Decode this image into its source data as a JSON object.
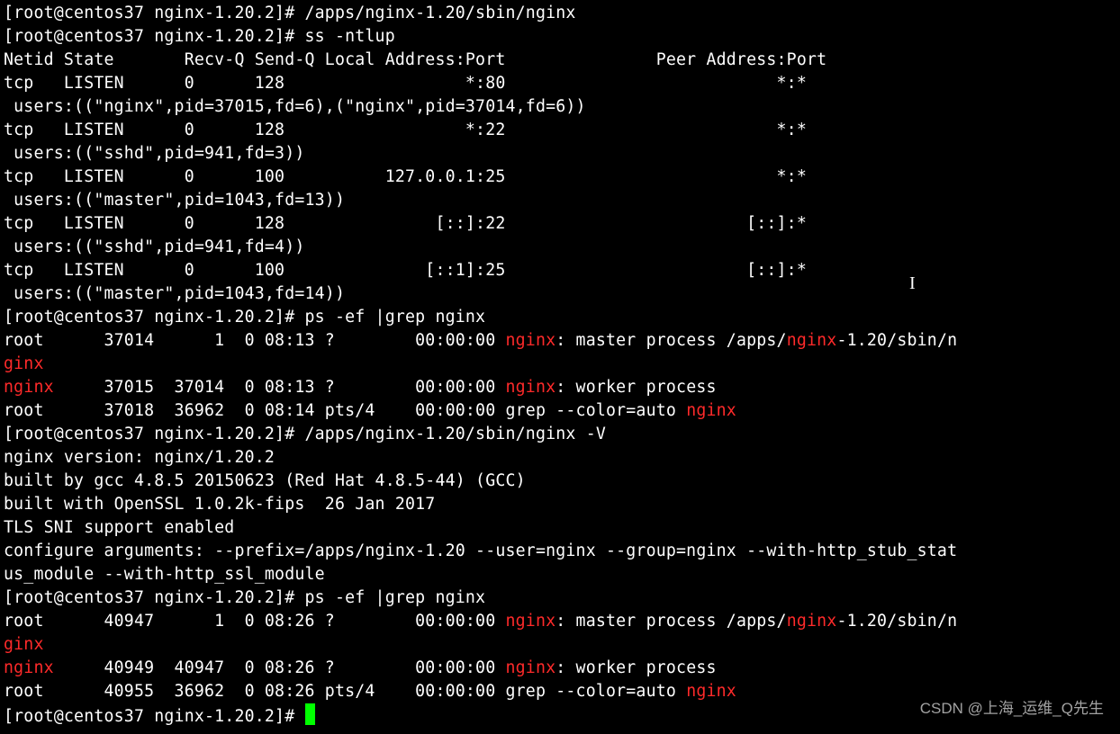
{
  "lines": [
    {
      "segs": [
        {
          "t": "[root@centos37 nginx-1.20.2]# /apps/nginx-1.20/sbin/nginx"
        }
      ]
    },
    {
      "segs": [
        {
          "t": "[root@centos37 nginx-1.20.2]# ss -ntlup"
        }
      ]
    },
    {
      "segs": [
        {
          "t": "Netid State       Recv-Q Send-Q Local Address:Port               Peer Address:Port"
        }
      ]
    },
    {
      "segs": [
        {
          "t": "tcp   LISTEN      0      128                  *:80                           *:*"
        }
      ]
    },
    {
      "segs": [
        {
          "t": " users:((\"nginx\",pid=37015,fd=6),(\"nginx\",pid=37014,fd=6))"
        }
      ]
    },
    {
      "segs": [
        {
          "t": "tcp   LISTEN      0      128                  *:22                           *:*"
        }
      ]
    },
    {
      "segs": [
        {
          "t": " users:((\"sshd\",pid=941,fd=3))"
        }
      ]
    },
    {
      "segs": [
        {
          "t": "tcp   LISTEN      0      100          127.0.0.1:25                           *:*"
        }
      ]
    },
    {
      "segs": [
        {
          "t": " users:((\"master\",pid=1043,fd=13))"
        }
      ]
    },
    {
      "segs": [
        {
          "t": "tcp   LISTEN      0      128               [::]:22                        [::]:*"
        }
      ]
    },
    {
      "segs": [
        {
          "t": " users:((\"sshd\",pid=941,fd=4))"
        }
      ]
    },
    {
      "segs": [
        {
          "t": "tcp   LISTEN      0      100              [::1]:25                        [::]:*"
        }
      ]
    },
    {
      "segs": [
        {
          "t": " users:((\"master\",pid=1043,fd=14))"
        }
      ]
    },
    {
      "segs": [
        {
          "t": "[root@centos37 nginx-1.20.2]# ps -ef |grep nginx"
        }
      ]
    },
    {
      "segs": [
        {
          "t": "root      37014      1  0 08:13 ?        00:00:00 "
        },
        {
          "t": "nginx",
          "c": "r"
        },
        {
          "t": ": master process /apps/"
        },
        {
          "t": "nginx",
          "c": "r"
        },
        {
          "t": "-1.20/sbin/n"
        }
      ]
    },
    {
      "segs": [
        {
          "t": "ginx",
          "c": "r"
        }
      ]
    },
    {
      "segs": [
        {
          "t": "nginx",
          "c": "r"
        },
        {
          "t": "     37015  37014  0 08:13 ?        00:00:00 "
        },
        {
          "t": "nginx",
          "c": "r"
        },
        {
          "t": ": worker process"
        }
      ]
    },
    {
      "segs": [
        {
          "t": "root      37018  36962  0 08:14 pts/4    00:00:00 grep --color=auto "
        },
        {
          "t": "nginx",
          "c": "r"
        }
      ]
    },
    {
      "segs": [
        {
          "t": "[root@centos37 nginx-1.20.2]# /apps/nginx-1.20/sbin/nginx -V"
        }
      ]
    },
    {
      "segs": [
        {
          "t": "nginx version: nginx/1.20.2"
        }
      ]
    },
    {
      "segs": [
        {
          "t": "built by gcc 4.8.5 20150623 (Red Hat 4.8.5-44) (GCC)"
        }
      ]
    },
    {
      "segs": [
        {
          "t": "built with OpenSSL 1.0.2k-fips  26 Jan 2017"
        }
      ]
    },
    {
      "segs": [
        {
          "t": "TLS SNI support enabled"
        }
      ]
    },
    {
      "segs": [
        {
          "t": "configure arguments: --prefix=/apps/nginx-1.20 --user=nginx --group=nginx --with-http_stub_stat"
        }
      ]
    },
    {
      "segs": [
        {
          "t": "us_module --with-http_ssl_module"
        }
      ]
    },
    {
      "segs": [
        {
          "t": "[root@centos37 nginx-1.20.2]# ps -ef |grep nginx"
        }
      ]
    },
    {
      "segs": [
        {
          "t": "root      40947      1  0 08:26 ?        00:00:00 "
        },
        {
          "t": "nginx",
          "c": "r"
        },
        {
          "t": ": master process /apps/"
        },
        {
          "t": "nginx",
          "c": "r"
        },
        {
          "t": "-1.20/sbin/n"
        }
      ]
    },
    {
      "segs": [
        {
          "t": "ginx",
          "c": "r"
        }
      ]
    },
    {
      "segs": [
        {
          "t": "nginx",
          "c": "r"
        },
        {
          "t": "     40949  40947  0 08:26 ?        00:00:00 "
        },
        {
          "t": "nginx",
          "c": "r"
        },
        {
          "t": ": worker process"
        }
      ]
    },
    {
      "segs": [
        {
          "t": "root      40955  36962  0 08:26 pts/4    00:00:00 grep --color=auto "
        },
        {
          "t": "nginx",
          "c": "r"
        }
      ]
    },
    {
      "segs": [
        {
          "t": "[root@centos37 nginx-1.20.2]# "
        },
        {
          "cursor": true
        }
      ]
    }
  ],
  "watermark": "CSDN @上海_运维_Q先生",
  "text_cursor": "I"
}
